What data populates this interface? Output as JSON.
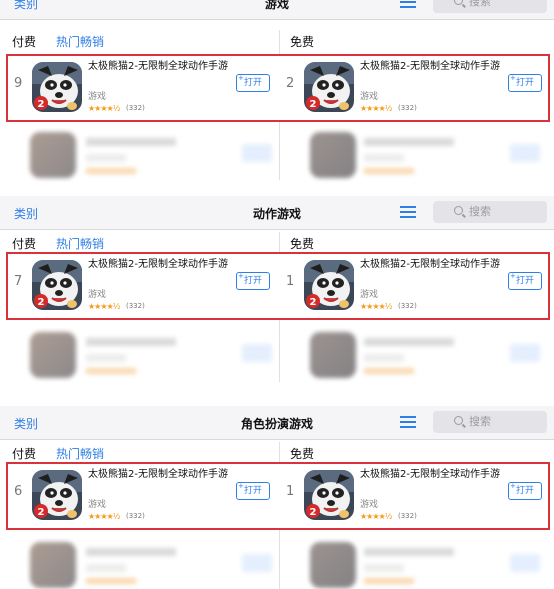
{
  "panels": [
    {
      "nav": {
        "category": "类别",
        "title": "游戏",
        "search_placeholder": "搜索"
      },
      "tabs": {
        "paid": "付费",
        "hot": "热门畅销",
        "free": "免费"
      },
      "left": {
        "rank": "9",
        "name": "太极熊猫2-无限制全球动作手游",
        "category": "游戏",
        "stars": "★★★★½",
        "count": "(332)",
        "button": "打开"
      },
      "right": {
        "rank": "2",
        "name": "太极熊猫2-无限制全球动作手游",
        "category": "游戏",
        "stars": "★★★★½",
        "count": "(332)",
        "button": "打开"
      }
    },
    {
      "nav": {
        "category": "类别",
        "title": "动作游戏",
        "search_placeholder": "搜索"
      },
      "tabs": {
        "paid": "付费",
        "hot": "热门畅销",
        "free": "免费"
      },
      "left": {
        "rank": "7",
        "name": "太极熊猫2-无限制全球动作手游",
        "category": "游戏",
        "stars": "★★★★½",
        "count": "(332)",
        "button": "打开"
      },
      "right": {
        "rank": "1",
        "name": "太极熊猫2-无限制全球动作手游",
        "category": "游戏",
        "stars": "★★★★½",
        "count": "(332)",
        "button": "打开"
      }
    },
    {
      "nav": {
        "category": "类别",
        "title": "角色扮演游戏",
        "search_placeholder": "搜索"
      },
      "tabs": {
        "paid": "付费",
        "hot": "热门畅销",
        "free": "免费"
      },
      "left": {
        "rank": "6",
        "name": "太极熊猫2-无限制全球动作手游",
        "category": "游戏",
        "stars": "★★★★½",
        "count": "(332)",
        "button": "打开"
      },
      "right": {
        "rank": "1",
        "name": "太极熊猫2-无限制全球动作手游",
        "category": "游戏",
        "stars": "★★★★½",
        "count": "(332)",
        "button": "打开"
      }
    }
  ],
  "colors": {
    "accent": "#2f7fe6",
    "highlight": "#d8323a",
    "star": "#f39b1b"
  }
}
